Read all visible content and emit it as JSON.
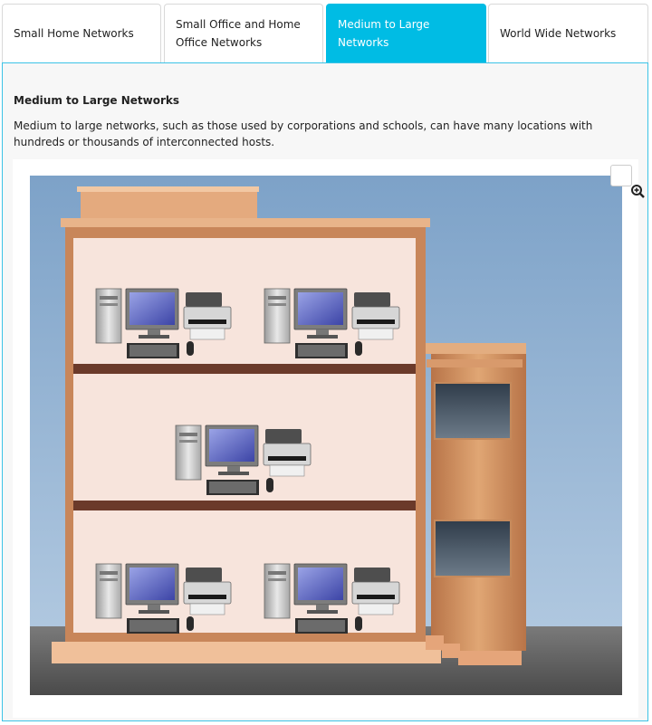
{
  "tabs": [
    {
      "label": "Small Home Networks",
      "active": false
    },
    {
      "label": "Small Office and Home Office Networks",
      "active": false
    },
    {
      "label": "Medium to Large Networks",
      "active": true
    },
    {
      "label": "World Wide Networks",
      "active": false
    }
  ],
  "content": {
    "title": "Medium to Large Networks",
    "description": "Medium to large networks, such as those used by corporations and schools, can have many locations with hundreds or thousands of interconnected hosts."
  },
  "figure": {
    "zoom_icon": "zoom-in-icon",
    "workstations_per_floor": [
      2,
      1,
      2
    ]
  },
  "colors": {
    "accent": "#00bce4",
    "sky_top": "#7da2c8",
    "sky_bottom": "#b7cde3",
    "building": "#d4905e",
    "floor_band": "#6b3a2a",
    "wall": "#f7e4dc"
  }
}
